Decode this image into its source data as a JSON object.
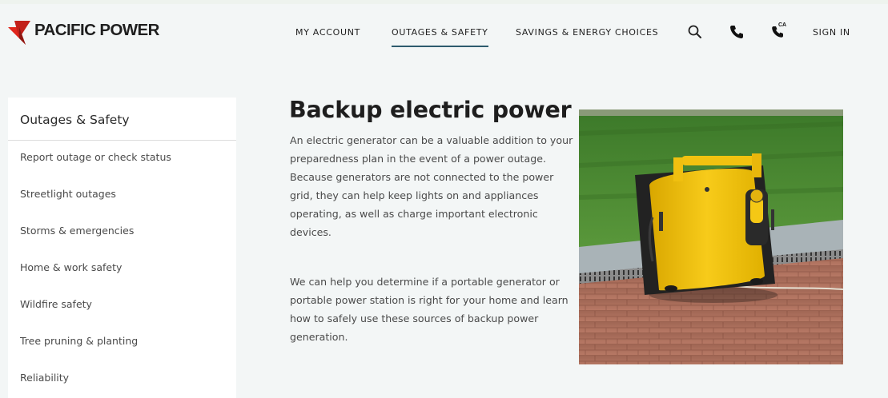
{
  "brand": {
    "name": "PACIFIC POWER",
    "colors": {
      "red": "#e1261c",
      "dark_red": "#a31a13",
      "accent_line": "#2d5b6e"
    }
  },
  "nav": {
    "items": [
      "MY ACCOUNT",
      "OUTAGES & SAFETY",
      "SAVINGS & ENERGY CHOICES"
    ],
    "active": "OUTAGES & SAFETY",
    "phone_badge": "CA",
    "sign_in": "SIGN IN",
    "icons": [
      "search-icon",
      "phone-icon",
      "state-phone-icon"
    ]
  },
  "sidebar": {
    "title": "Outages & Safety",
    "items": [
      "Report outage or check status",
      "Streetlight outages",
      "Storms & emergencies",
      "Home & work safety",
      "Wildfire safety",
      "Tree pruning & planting",
      "Reliability"
    ]
  },
  "main": {
    "title": "Backup electric power",
    "paragraphs": [
      "An electric generator can be a valuable addition to your preparedness plan in the event of a power outage. Because generators are not connected to the power grid, they can help keep lights on and appliances operating, as well as charge important electronic devices.",
      "We can help you determine if a portable generator or portable power station is right for your home and learn how to safely use these sources of backup power generation."
    ],
    "image_alt": "Portable yellow generator on brick pavement in front of grass"
  }
}
